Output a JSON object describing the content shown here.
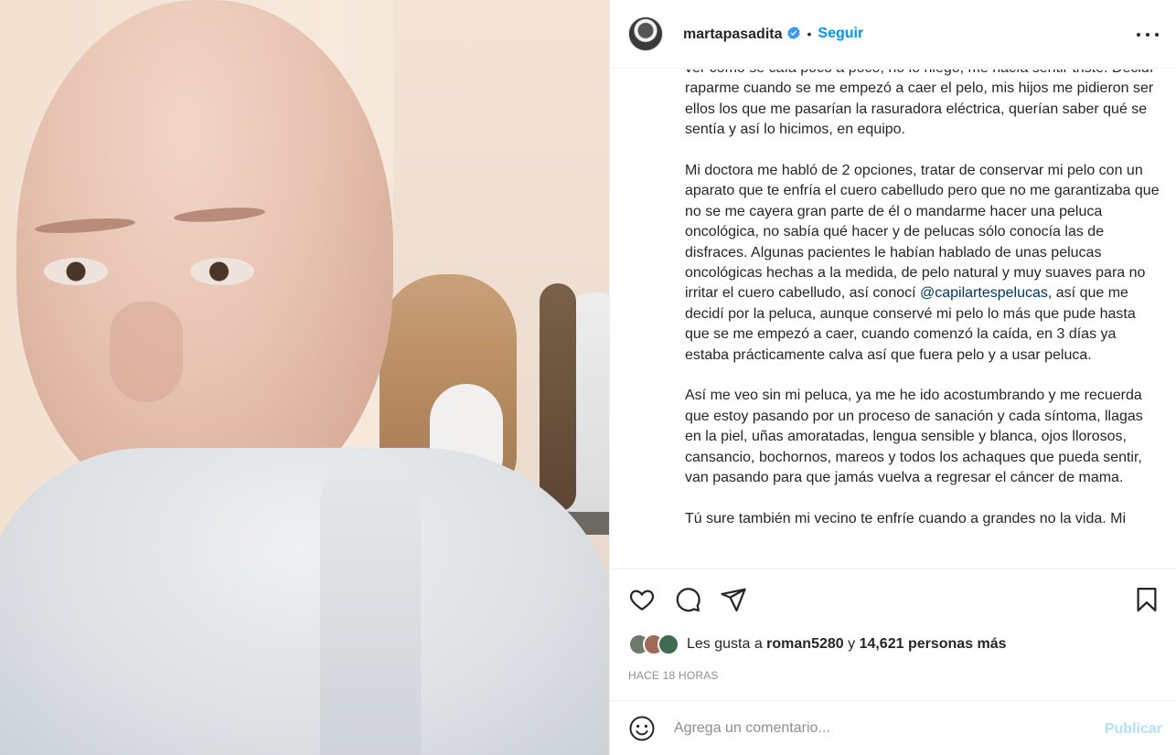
{
  "header": {
    "username": "martapasadita",
    "dot": "•",
    "follow_label": "Seguir",
    "verified_color": "#3897f0"
  },
  "caption": {
    "p1": "ver cómo se caía poco a poco, no lo niego, me hacía sentir triste. Decidí raparme cuando se me empezó a caer el pelo, mis hijos me pidieron ser ellos los que me pasarían la rasuradora eléctrica, querían saber qué se sentía y así lo hicimos, en equipo.",
    "p2_before": "Mi doctora me habló de 2 opciones, tratar de conservar mi pelo con un aparato que te enfría el cuero cabelludo pero que no me garantizaba que no se me cayera gran parte de él o mandarme hacer una peluca oncológica, no sabía qué hacer y de pelucas sólo conocía las de disfraces. Algunas pacientes le habían hablado de unas pelucas oncológicas hechas a la medida, de pelo natural y muy suaves para no irritar el cuero cabelludo, así conocí ",
    "p2_mention": "@capilartespelucas",
    "p2_after": ", así que me decidí por la peluca, aunque conservé mi pelo lo más que pude hasta que se me empezó a caer, cuando comenzó la caída, en 3 días ya estaba prácticamente calva así que fuera pelo y a usar peluca.",
    "p3": "Así me veo sin mi peluca, ya me he ido acostumbrando y me recuerda que estoy pasando por un proceso de sanación y cada síntoma, llagas en la piel, uñas amoratadas, lengua sensible y blanca, ojos llorosos, cansancio, bochornos, mareos y todos los achaques que pueda sentir, van pasando para que jamás vuelva a regresar el cáncer de mama.",
    "p4_partial": "Tú sure también mi vecino te enfríe cuando a grandes no la vida. Mi"
  },
  "actions": {
    "like_icon": "heart-icon",
    "comment_icon": "comment-icon",
    "share_icon": "send-icon",
    "save_icon": "bookmark-icon"
  },
  "likes": {
    "prefix": "Les gusta a ",
    "user": "roman5280",
    "middle": " y ",
    "count": "14,621 personas más"
  },
  "timestamp": "HACE 18 HORAS",
  "comment": {
    "placeholder": "Agrega un comentario...",
    "post_label": "Publicar",
    "emoji_icon": "emoji-icon"
  }
}
